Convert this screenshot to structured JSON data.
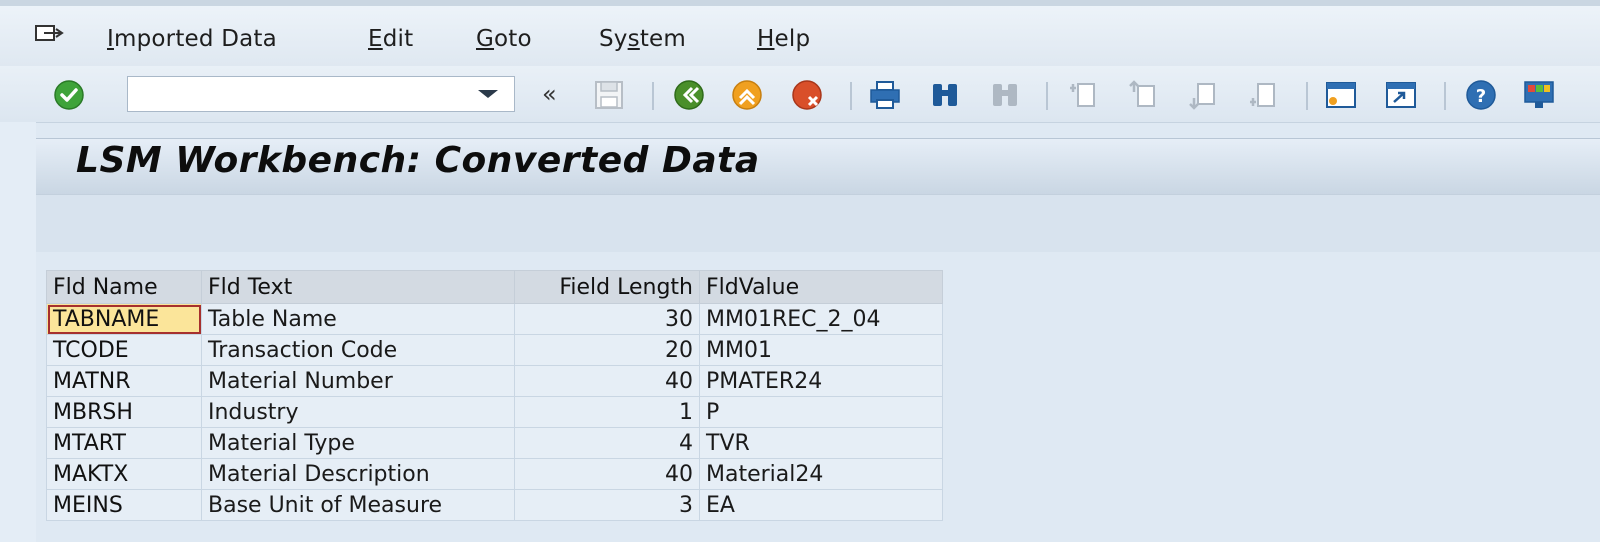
{
  "menu": {
    "items": [
      {
        "pre": "",
        "u": "I",
        "post": "mported Data"
      },
      {
        "pre": "",
        "u": "E",
        "post": "dit"
      },
      {
        "pre": "",
        "u": "G",
        "post": "oto"
      },
      {
        "pre": "Sy",
        "u": "s",
        "post": "tem"
      },
      {
        "pre": "",
        "u": "H",
        "post": "elp"
      }
    ]
  },
  "toolbar": {
    "command_value": "",
    "icons": [
      "enter-icon",
      "back-double-icon",
      "save-icon",
      "back-icon",
      "exit-icon",
      "cancel-icon",
      "print-icon",
      "find-icon",
      "find-next-icon",
      "first-page-icon",
      "previous-page-icon",
      "next-page-icon",
      "last-page-icon",
      "create-session-icon",
      "shortcut-icon",
      "help-icon",
      "customize-layout-icon"
    ],
    "colors": {
      "enter": "#3fa33a",
      "back": "#4a8f2a",
      "exit": "#f0a020",
      "cancel": "#d94f2a",
      "help": "#2f6fb3"
    }
  },
  "page": {
    "title": "LSM Workbench: Converted Data"
  },
  "table": {
    "headers": [
      "Fld Name",
      "Fld Text",
      "Field Length",
      "FldValue"
    ],
    "rows": [
      {
        "name": "TABNAME",
        "text": "Table Name",
        "length": "30",
        "value": "MM01REC_2_04"
      },
      {
        "name": "TCODE",
        "text": "Transaction Code",
        "length": "20",
        "value": "MM01"
      },
      {
        "name": "MATNR",
        "text": "Material Number",
        "length": "40",
        "value": "PMATER24"
      },
      {
        "name": "MBRSH",
        "text": "Industry",
        "length": "1",
        "value": "P"
      },
      {
        "name": "MTART",
        "text": "Material Type",
        "length": "4",
        "value": "TVR"
      },
      {
        "name": "MAKTX",
        "text": "Material Description",
        "length": "40",
        "value": "Material24"
      },
      {
        "name": "MEINS",
        "text": "Base Unit of Measure",
        "length": "3",
        "value": "EA"
      }
    ]
  }
}
